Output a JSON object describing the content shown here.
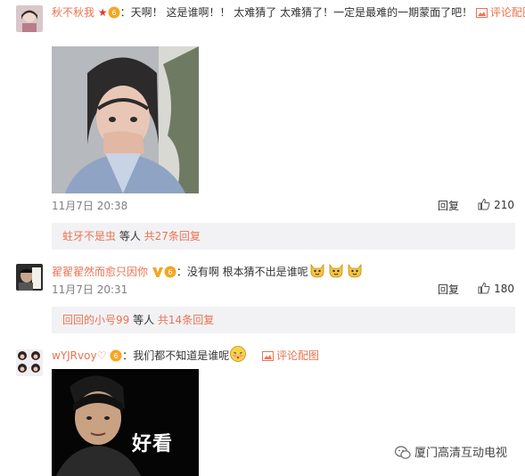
{
  "comments": [
    {
      "user": "秋不秋我",
      "colon": "：",
      "text": "天啊！ 这是谁啊！！ 太难猜了 太难猜了！一定是最难的一期蒙面了吧！",
      "link": "评论配图",
      "time": "11月7日 20:38",
      "reply_label": "回复",
      "likes": "210",
      "thread": {
        "name": "蛀牙不是虫",
        "mid": " 等人 ",
        "count": "共27条回复"
      }
    },
    {
      "user": "翟翟翟然而愈只因你",
      "colon": "：",
      "text": "没有啊 根本猜不出是谁呢",
      "time": "11月7日 20:31",
      "reply_label": "回复",
      "likes": "180",
      "thread": {
        "name": "回回的小号99",
        "mid": " 等人 ",
        "count": "共14条回复"
      }
    },
    {
      "user": "wYJRvoy",
      "colon": "：",
      "text": "我们都不知道是谁呢",
      "link": "评论配图",
      "image_caption": "好看"
    }
  ],
  "watermark": "厦门高清互动电视",
  "colors": {
    "accent": "#eb7350",
    "reply_bg": "#f2f2f5"
  },
  "icons": [
    "star-icon",
    "vip-icon",
    "picture-icon",
    "thumbs-up-icon",
    "v-badge-icon",
    "emoji-dog-icon",
    "emoji-shy-icon",
    "wechat-icon"
  ]
}
